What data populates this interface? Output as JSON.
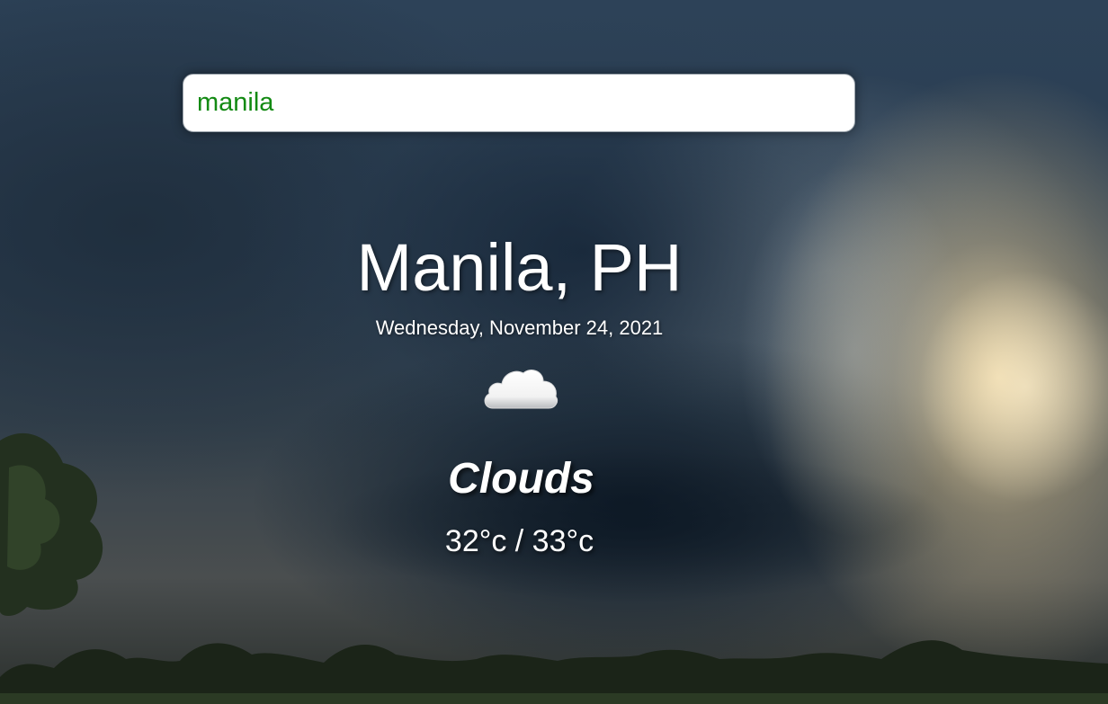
{
  "search": {
    "value": "manila"
  },
  "weather": {
    "location": "Manila, PH",
    "date": "Wednesday, November 24, 2021",
    "icon": "cloud-icon",
    "condition": "Clouds",
    "temperature_range": "32°c / 33°c"
  },
  "colors": {
    "search_text": "#138a13",
    "text": "#ffffff"
  }
}
